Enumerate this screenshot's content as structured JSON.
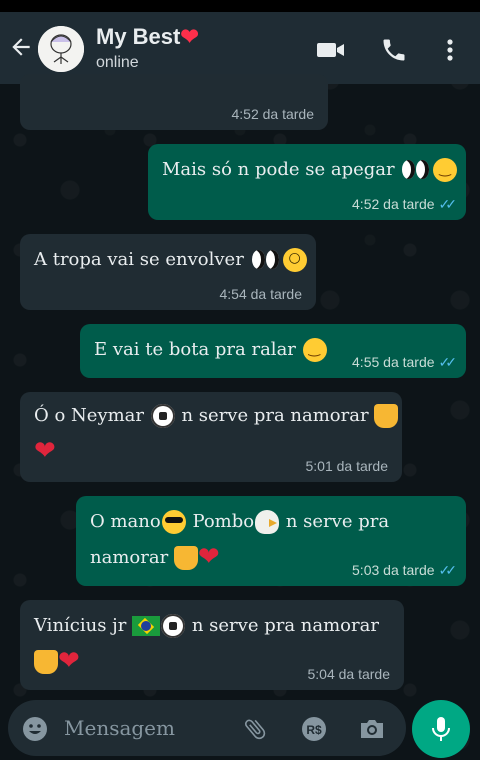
{
  "header": {
    "title": "My Best",
    "title_emoji": "❤",
    "status": "online"
  },
  "messages": [
    {
      "direction": "in",
      "text": "",
      "time": "4:52 da tarde"
    },
    {
      "direction": "out",
      "text": "Mais só n pode se apegar",
      "time": "4:52 da tarde",
      "ticks": "✓✓"
    },
    {
      "direction": "in",
      "text": "A tropa vai se envolver",
      "time": "4:54 da tarde"
    },
    {
      "direction": "out",
      "text": "E vai te bota pra ralar",
      "time": "4:55 da tarde",
      "ticks": "✓✓"
    },
    {
      "direction": "in",
      "text_a": "Ó o Neymar",
      "text_b": "n serve pra namorar",
      "time": "5:01 da tarde"
    },
    {
      "direction": "out",
      "text_a": "O mano",
      "text_b": "Pombo",
      "text_c": "n serve pra",
      "text_d": "namorar",
      "time": "5:03 da tarde",
      "ticks": "✓✓"
    },
    {
      "direction": "in",
      "text_a": "Vinícius jr",
      "text_b": "n serve pra namorar",
      "time": "5:04 da tarde"
    }
  ],
  "composer": {
    "placeholder": "Mensagem"
  },
  "icons": {
    "back": "arrow-left-icon",
    "video": "video-call-icon",
    "phone": "phone-icon",
    "menu": "more-vert-icon",
    "emoji": "emoji-icon",
    "attach": "paperclip-icon",
    "payment": "payment-icon",
    "camera": "camera-icon",
    "mic": "mic-icon"
  },
  "colors": {
    "header_bg": "#1f2c34",
    "incoming_bubble": "#202c33",
    "outgoing_bubble": "#005c4b",
    "read_ticks": "#53bdeb",
    "mic_button": "#00a884"
  }
}
